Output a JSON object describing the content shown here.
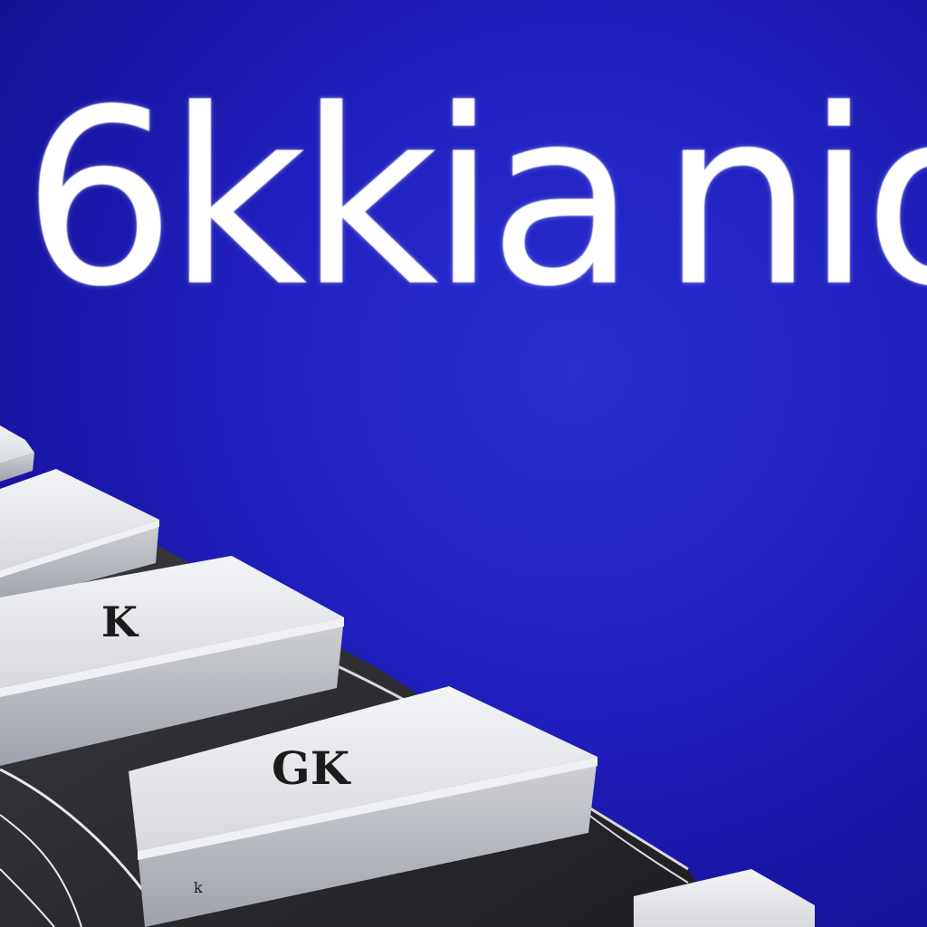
{
  "headline": {
    "word_1": "6kkia",
    "word_2": "nioga"
  },
  "keys": {
    "key_k": "K",
    "key_gk": "GK",
    "key_small": "k"
  },
  "colors": {
    "background": "#1f20bf",
    "headline": "#ffffff",
    "keycap": "#e6e7ea",
    "keycap_side": "#bfc1c7",
    "keyboard_base": "#2b2b30"
  }
}
